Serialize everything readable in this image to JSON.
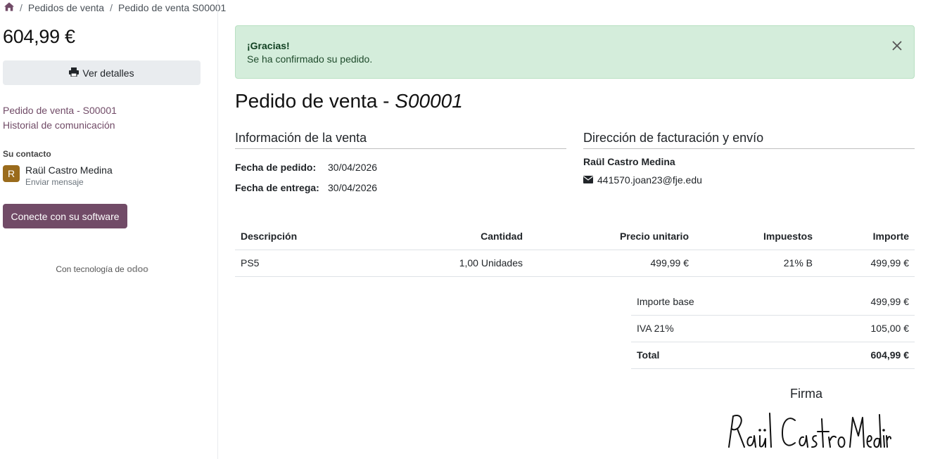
{
  "breadcrumb": {
    "items": [
      "Pedidos de venta",
      "Pedido de venta S00001"
    ]
  },
  "sidebar": {
    "amount": "604,99 €",
    "details_button": "Ver detalles",
    "links": [
      "Pedido de venta - S00001",
      "Historial de comunicación"
    ],
    "contact_title": "Su contacto",
    "contact": {
      "initial": "R",
      "name": "Raül Castro Medina",
      "action": "Enviar mensaje"
    },
    "connect_button": "Conecte con su software",
    "powered_text": "Con tecnología de",
    "powered_brand": "odoo"
  },
  "alert": {
    "title": "¡Gracias!",
    "message": "Se ha confirmado su pedido."
  },
  "order": {
    "title_prefix": "Pedido de venta - ",
    "title_ref": "S00001",
    "sales_info_title": "Información de la venta",
    "billing_title": "Dirección de facturación y envío",
    "order_date_label": "Fecha de pedido:",
    "order_date": "30/04/2026",
    "delivery_date_label": "Fecha de entrega:",
    "delivery_date": "30/04/2026",
    "customer_name": "Raül Castro Medina",
    "customer_email": "441570.joan23@fje.edu"
  },
  "lines": {
    "headers": [
      "Descripción",
      "Cantidad",
      "Precio unitario",
      "Impuestos",
      "Importe"
    ],
    "rows": [
      [
        "PS5",
        "1,00 Unidades",
        "499,99 €",
        "21% B",
        "499,99 €"
      ]
    ]
  },
  "totals": {
    "base_label": "Importe base",
    "base_value": "499,99 €",
    "tax_label": "IVA 21%",
    "tax_value": "105,00 €",
    "total_label": "Total",
    "total_value": "604,99 €"
  },
  "signature": {
    "label": "Firma",
    "signed_name": "Raül Castro Medina"
  },
  "colors": {
    "primary": "#714b67",
    "alert_bg": "#d4eddb",
    "avatar": "#9a6b1c"
  }
}
